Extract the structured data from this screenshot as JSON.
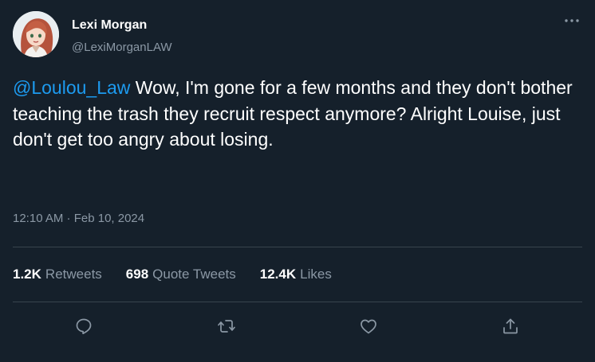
{
  "author": {
    "name": "Lexi Morgan",
    "handle": "@LexiMorganLAW"
  },
  "tweet": {
    "mention": "@Loulou_Law",
    "text": " Wow, I'm gone for a few months and they don't bother teaching the trash they recruit respect anymore? Alright Louise, just don't get too angry about losing.",
    "timestamp": "12:10 AM · Feb 10, 2024"
  },
  "stats": {
    "retweets_count": "1.2K",
    "retweets_label": "Retweets",
    "quotes_count": "698",
    "quotes_label": "Quote Tweets",
    "likes_count": "12.4K",
    "likes_label": "Likes"
  },
  "icons": {
    "more": "more-horizontal-icon",
    "reply": "reply-icon",
    "retweet": "retweet-icon",
    "like": "heart-icon",
    "share": "share-icon"
  },
  "colors": {
    "background": "#15202b",
    "accent": "#1d9bf0",
    "secondary_text": "#8b98a5",
    "divider": "#38444d"
  }
}
